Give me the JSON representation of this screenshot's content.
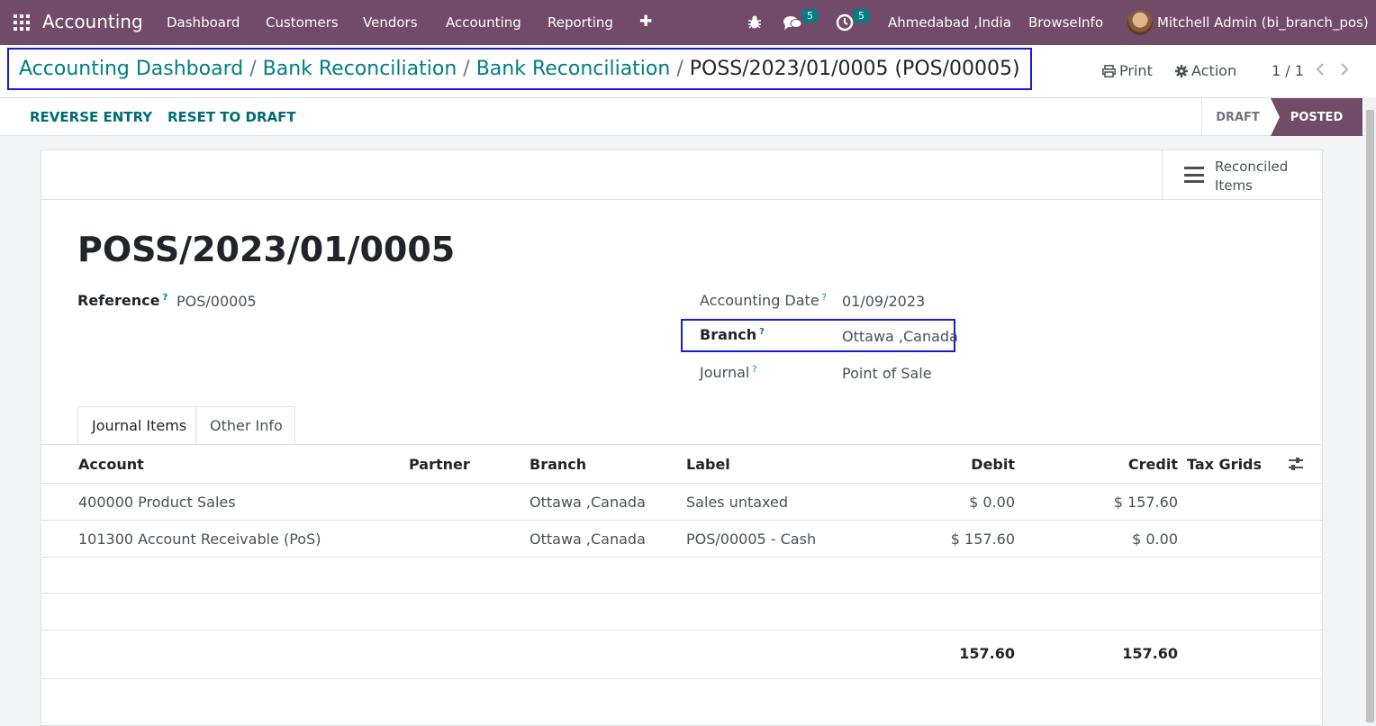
{
  "topbar": {
    "app_name": "Accounting",
    "menu": [
      "Dashboard",
      "Customers",
      "Vendors",
      "Accounting",
      "Reporting"
    ],
    "add_glyph": "✚",
    "messages_count": "5",
    "activities_count": "5",
    "company": "Ahmedabad ,India",
    "website": "BrowseInfo",
    "user": "Mitchell Admin (bi_branch_pos)",
    "color": "#714b67"
  },
  "breadcrumb": {
    "items": [
      "Accounting Dashboard",
      "Bank Reconciliation",
      "Bank Reconciliation"
    ],
    "separator": "/",
    "current": "POSS/2023/01/0005 (POS/00005)"
  },
  "control": {
    "print_label": "Print",
    "action_label": "Action",
    "pager": "1 / 1"
  },
  "buttons": {
    "reverse_entry": "REVERSE ENTRY",
    "reset_to_draft": "RESET TO DRAFT"
  },
  "status": {
    "draft": "DRAFT",
    "posted": "POSTED",
    "current": "POSTED"
  },
  "smart_button": {
    "label": "Reconciled Items"
  },
  "record": {
    "title": "POSS/2023/01/0005",
    "reference_label": "Reference",
    "reference_value": "POS/00005",
    "accounting_date_label": "Accounting Date",
    "accounting_date_value": "01/09/2023",
    "branch_label": "Branch",
    "branch_value": "Ottawa ,Canada",
    "journal_label": "Journal",
    "journal_value": "Point of Sale",
    "help_glyph": "?"
  },
  "tabs": [
    "Journal Items",
    "Other Info"
  ],
  "table": {
    "columns": [
      "Account",
      "Partner",
      "Branch",
      "Label",
      "Debit",
      "Credit",
      "Tax Grids"
    ],
    "rows": [
      {
        "account": "400000 Product Sales",
        "partner": "",
        "branch": "Ottawa ,Canada",
        "label": "Sales untaxed",
        "debit": "$ 0.00",
        "credit": "$ 157.60",
        "tax_grids": ""
      },
      {
        "account": "101300 Account Receivable (PoS)",
        "partner": "",
        "branch": "Ottawa ,Canada",
        "label": "POS/00005 - Cash",
        "debit": "$ 157.60",
        "credit": "$ 0.00",
        "tax_grids": ""
      }
    ],
    "totals": {
      "debit": "157.60",
      "credit": "157.60"
    }
  }
}
